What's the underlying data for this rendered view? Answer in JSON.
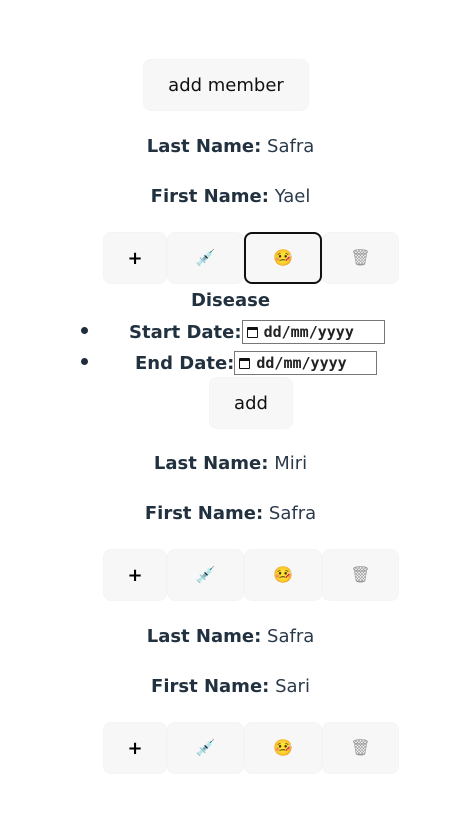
{
  "header": {
    "add_member_label": "add member"
  },
  "members": [
    {
      "last_name_label": "Last Name:",
      "last_name": "Safra",
      "first_name_label": "First Name:",
      "first_name": "Yael"
    },
    {
      "last_name_label": "Last Name:",
      "last_name": "Miri",
      "first_name_label": "First Name:",
      "first_name": "Safra"
    },
    {
      "last_name_label": "Last Name:",
      "last_name": "Safra",
      "first_name_label": "First Name:",
      "first_name": "Sari"
    }
  ],
  "actions": {
    "add_symbol": "+",
    "vaccine_glyph": "💉",
    "sick_glyph": "🤒",
    "trash_glyph": "🗑"
  },
  "disease_form": {
    "title": "Disease",
    "start_label": "Start Date:",
    "end_label": "End Date:",
    "start_placeholder": "dd/mm/yyyy",
    "end_placeholder": "dd/mm/yyyy",
    "add_label": "add"
  }
}
